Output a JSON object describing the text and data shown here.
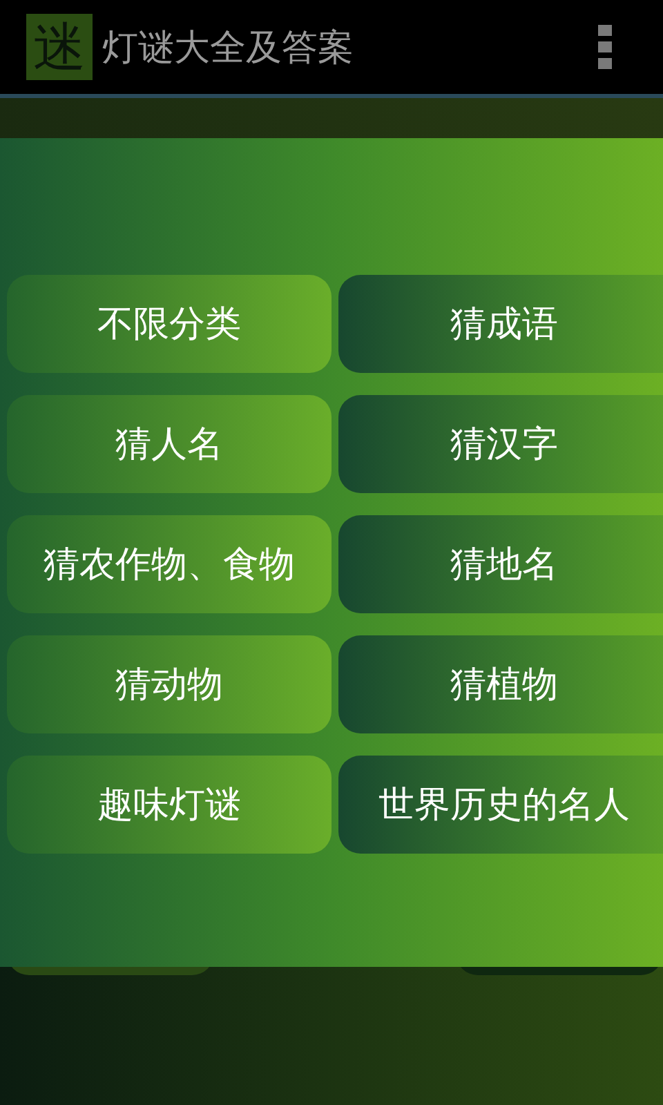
{
  "app_bar": {
    "logo": "迷",
    "title": "灯谜大全及答案"
  },
  "categories": [
    {
      "label": "不限分类"
    },
    {
      "label": "猜成语"
    },
    {
      "label": "猜人名"
    },
    {
      "label": "猜汉字"
    },
    {
      "label": "猜农作物、食物"
    },
    {
      "label": "猜地名"
    },
    {
      "label": "猜动物"
    },
    {
      "label": "猜植物"
    },
    {
      "label": "趣味灯谜"
    },
    {
      "label": "世界历史的名人"
    }
  ]
}
